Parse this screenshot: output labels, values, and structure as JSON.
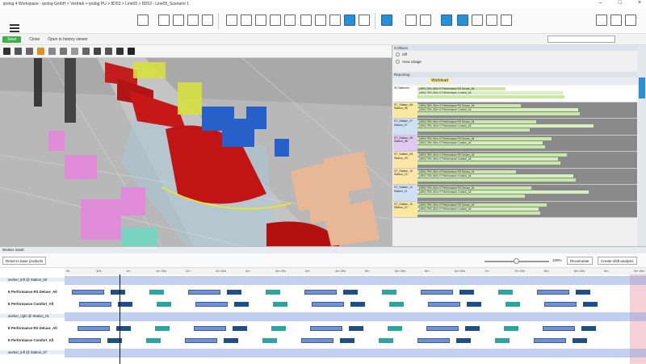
{
  "window": {
    "title": "ipolog 4 Workspace - ipolog GmbH > Vertrieb > ipolog PU > 8D53 > Line05 > 8D53 - Line05_Scenario 1",
    "controls": [
      "–",
      "□",
      "×"
    ]
  },
  "toolbar": {
    "menu_icon": "hamburger-icon"
  },
  "subbar": {
    "save_label": "Save",
    "close_label": "Close",
    "history_label": "Open in history viewer",
    "search_placeholder": ""
  },
  "right_panel": {
    "overlay_title": "Collision",
    "radio_off": "Off",
    "radio_area": "Area Usage",
    "reporting_title": "Reporting",
    "workload_col": "Workload",
    "stations": [
      {
        "name": "W Stationen",
        "color": "#ffffff"
      },
      {
        "name": "ST_Station_06 Station_06",
        "color": "#f8e8a0"
      },
      {
        "name": "ST_Station_07 Station_07",
        "color": "#cfe0f5"
      },
      {
        "name": "ST_Station_08 Station_08",
        "color": "#e0c8f0"
      },
      {
        "name": "ST_Station_09 Station_09",
        "color": "#fde6a8"
      },
      {
        "name": "ST_Station_10 Station_10",
        "color": "#fde6a8"
      },
      {
        "name": "ST_Station_11 Station_11",
        "color": "#cfe0f5"
      },
      {
        "name": "ST_Station_12 Station_12",
        "color": "#f8e8a0"
      }
    ],
    "row_text_1": "(48%) 78%, 80m: E Performance RS Deluxe_All",
    "row_text_2": "(48%) 75%, 80m: E Performance Comfort_All"
  },
  "gantt": {
    "title": "Worker Gantt",
    "reset_btn": "Reset to base products",
    "zoom_value": "100%",
    "recalculate_btn": "Recalculate",
    "shift_btn": "Create shift analysis",
    "ticks": [
      "0s",
      "30s",
      "1m",
      "1m 30s",
      "2m",
      "2m 30s",
      "3m",
      "3m 30s",
      "4m",
      "4m 30s",
      "5m",
      "5m 30s",
      "6m",
      "6m 30s",
      "7m",
      "7m 30s",
      "8m",
      "8m 30s",
      "9m",
      "9m 30s"
    ],
    "rows": [
      {
        "group": "worker_left @ Station_00",
        "product": ""
      },
      {
        "group": "",
        "product": "E Performance RS Deluxe_All"
      },
      {
        "group": "",
        "product": "E Performance Comfort_All"
      },
      {
        "group": "worker_right @ Station_01",
        "product": ""
      },
      {
        "group": "",
        "product": "E Performance RS Deluxe_All"
      },
      {
        "group": "",
        "product": "E Performance Comfort_All"
      },
      {
        "group": "worker_left @ Station_07",
        "product": ""
      }
    ]
  }
}
